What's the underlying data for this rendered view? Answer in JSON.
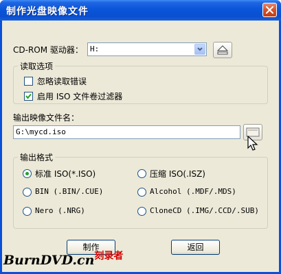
{
  "window": {
    "title": "制作光盘映像文件",
    "accent": "#0a4fd8",
    "close_icon": "close-icon"
  },
  "cdrom": {
    "label": "CD-ROM 驱动器：",
    "selected": "H:",
    "eject_icon": "eject-icon"
  },
  "read_options": {
    "title": "读取选项",
    "ignore_errors": {
      "label": "忽略读取错误",
      "checked": false
    },
    "iso_filter": {
      "label": "启用 ISO 文件卷过滤器",
      "checked": true
    }
  },
  "output": {
    "label": "输出映像文件名：",
    "value": "G:\\mycd.iso",
    "browse_icon": "folder-browse-icon"
  },
  "format": {
    "title": "输出格式",
    "options": [
      {
        "label": "标准 ISO(*.ISO)",
        "selected": true
      },
      {
        "label": "压缩 ISO(.ISZ)",
        "selected": false
      },
      {
        "label": "BIN (.BIN/.CUE)",
        "selected": false
      },
      {
        "label": "Alcohol (.MDF/.MDS)",
        "selected": false
      },
      {
        "label": "Nero (.NRG)",
        "selected": false
      },
      {
        "label": "CloneCD (.IMG/.CCD/.SUB)",
        "selected": false
      }
    ]
  },
  "buttons": {
    "make": "制作",
    "back": "返回"
  },
  "watermark": {
    "brand": "BurnDVD",
    "domain": ".cn",
    "tag": "刻录者"
  }
}
